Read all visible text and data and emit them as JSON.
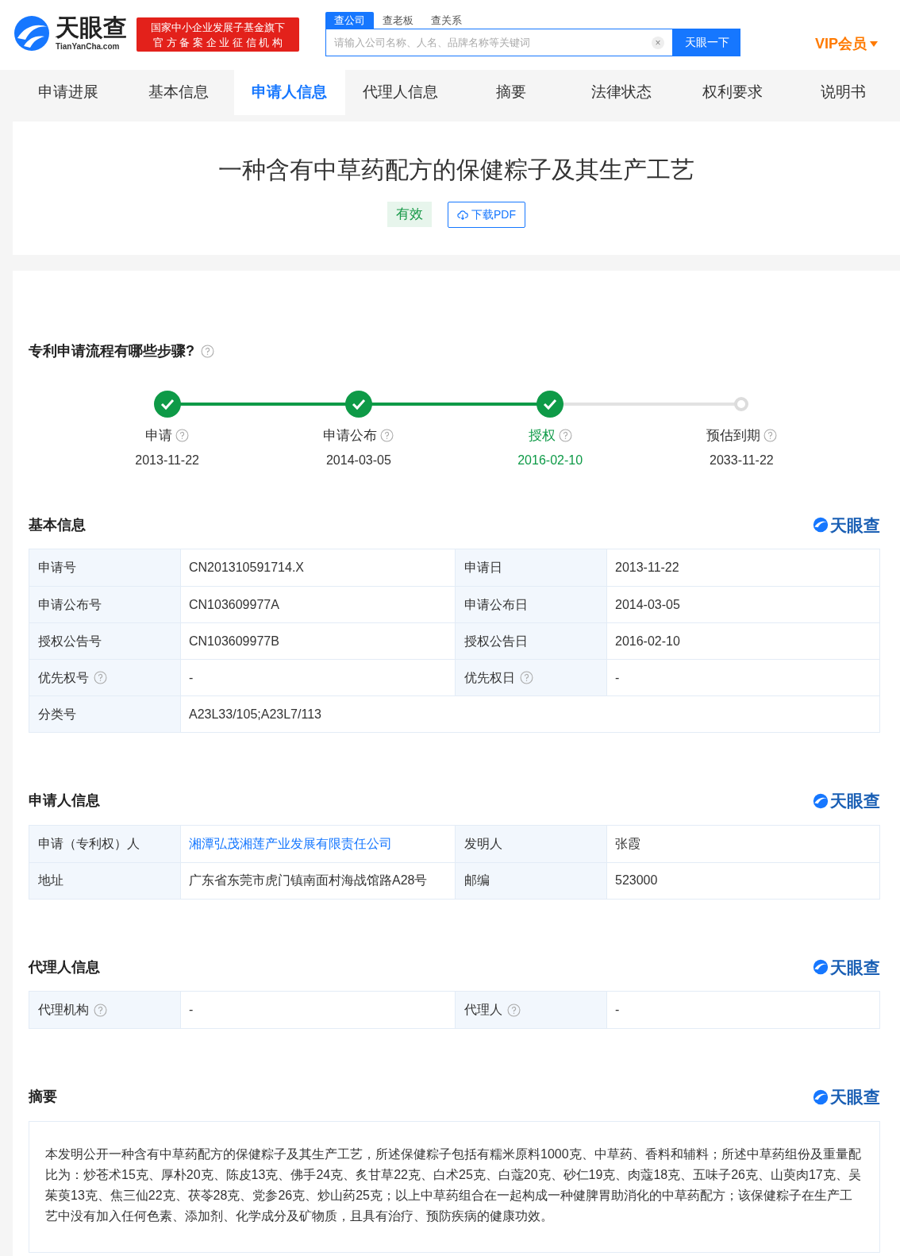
{
  "header": {
    "logo_text": "天眼查",
    "logo_sub": "TianYanCha.com",
    "badge_lines": [
      "国家中小企业发展子基金旗下",
      "官 方 备 案 企 业 征 信 机 构"
    ],
    "search_tabs": [
      {
        "label": "查公司",
        "selected": true
      },
      {
        "label": "查老板",
        "selected": false
      },
      {
        "label": "查关系",
        "selected": false
      }
    ],
    "search": {
      "placeholder": "请输入公司名称、人名、品牌名称等关键词",
      "clear": "×",
      "button": "天眼一下"
    },
    "vip": "VIP会员"
  },
  "nav": [
    {
      "label": "申请进展",
      "selected": false
    },
    {
      "label": "基本信息",
      "selected": false
    },
    {
      "label": "申请人信息",
      "selected": true
    },
    {
      "label": "代理人信息",
      "selected": false
    },
    {
      "label": "摘要",
      "selected": false
    },
    {
      "label": "法律状态",
      "selected": false
    },
    {
      "label": "权利要求",
      "selected": false
    },
    {
      "label": "说明书",
      "selected": false
    }
  ],
  "patent": {
    "title": "一种含有中草药配方的保健粽子及其生产工艺",
    "status": "有效",
    "download": "下载PDF"
  },
  "progress": {
    "title": "专利申请流程有哪些步骤?",
    "steps": [
      {
        "label": "申请",
        "date": "2013-11-22",
        "done": true,
        "selected": false
      },
      {
        "label": "申请公布",
        "date": "2014-03-05",
        "done": true,
        "selected": false
      },
      {
        "label": "授权",
        "date": "2016-02-10",
        "done": true,
        "selected": true
      },
      {
        "label": "预估到期",
        "date": "2033-11-22",
        "done": false,
        "selected": false
      }
    ]
  },
  "sections": [
    {
      "title": "基本信息",
      "brand": "天眼查",
      "rows": [
        [
          {
            "label": "申请号",
            "value": "CN201310591714.X"
          },
          {
            "label": "申请日",
            "value": "2013-11-22"
          }
        ],
        [
          {
            "label": "申请公布号",
            "value": "CN103609977A"
          },
          {
            "label": "申请公布日",
            "value": "2014-03-05"
          }
        ],
        [
          {
            "label": "授权公告号",
            "value": "CN103609977B"
          },
          {
            "label": "授权公告日",
            "value": "2016-02-10"
          }
        ],
        [
          {
            "label": "优先权号",
            "help": true,
            "value": "-"
          },
          {
            "label": "优先权日",
            "help": true,
            "value": "-"
          }
        ],
        [
          {
            "label": "分类号",
            "value": "A23L33/105;A23L7/113"
          }
        ]
      ]
    },
    {
      "title": "申请人信息",
      "brand": "天眼查",
      "rows": [
        [
          {
            "label": "申请（专利权）人",
            "value": "湘潭弘茂湘莲产业发展有限责任公司",
            "link": true
          },
          {
            "label": "发明人",
            "value": "张霞"
          }
        ],
        [
          {
            "label": "地址",
            "value": "广东省东莞市虎门镇南面村海战馆路A28号"
          },
          {
            "label": "邮编",
            "value": "523000"
          }
        ]
      ]
    },
    {
      "title": "代理人信息",
      "brand": "天眼查",
      "rows": [
        [
          {
            "label": "代理机构",
            "help": true,
            "value": "-"
          },
          {
            "label": "代理人",
            "help": true,
            "value": "-"
          }
        ]
      ]
    },
    {
      "title": "摘要",
      "brand": "天眼查",
      "text": "本发明公开一种含有中草药配方的保健粽子及其生产工艺，所述保健粽子包括有糯米原料1000克、中草药、香料和辅料；所述中草药组份及重量配比为：炒苍术15克、厚朴20克、陈皮13克、佛手24克、炙甘草22克、白术25克、白蔻20克、砂仁19克、肉蔻18克、五味子26克、山萸肉17克、吴茱萸13克、焦三仙22克、茯苓28克、党参26克、炒山药25克；以上中草药组合在一起构成一种健脾胃助消化的中草药配方；该保健粽子在生产工艺中没有加入任何色素、添加剂、化学成分及矿物质，且具有治疗、预防疾病的健康功效。"
    }
  ]
}
